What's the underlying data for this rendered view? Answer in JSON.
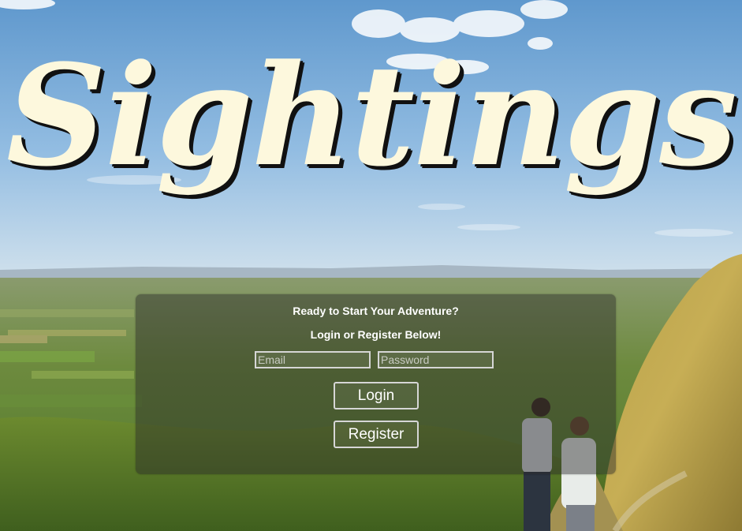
{
  "brand": {
    "title": "Sightings"
  },
  "login_panel": {
    "heading_primary": "Ready to Start Your Adventure?",
    "heading_secondary": "Login or Register Below!",
    "email": {
      "value": "",
      "placeholder": "Email"
    },
    "password": {
      "value": "",
      "placeholder": "Password"
    },
    "login_label": "Login",
    "register_label": "Register"
  },
  "colors": {
    "title_fill": "#fdf8dd",
    "title_shadow": "#111111",
    "panel_background": "rgba(40, 40, 40, 0.45)",
    "control_border": "#d6d6d6",
    "text": "#ffffff"
  }
}
